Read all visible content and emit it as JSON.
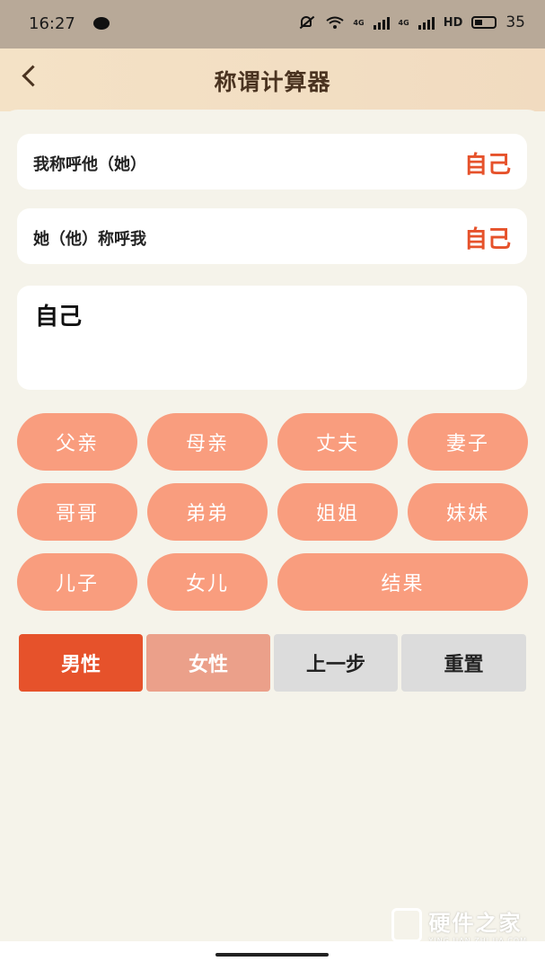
{
  "status_bar": {
    "time": "16:27",
    "battery": "35",
    "net1": "4G",
    "net2": "4G",
    "hd": "HD"
  },
  "header": {
    "title": "称谓计算器"
  },
  "rows": [
    {
      "label": "我称呼他（她）",
      "value": "自己"
    },
    {
      "label": "她（他）称呼我",
      "value": "自己"
    }
  ],
  "input": {
    "value": "自己"
  },
  "relation_buttons": {
    "father": "父亲",
    "mother": "母亲",
    "husband": "丈夫",
    "wife": "妻子",
    "elder_brother": "哥哥",
    "younger_brother": "弟弟",
    "elder_sister": "姐姐",
    "younger_sister": "妹妹",
    "son": "儿子",
    "daughter": "女儿",
    "result": "结果"
  },
  "controls": {
    "male": "男性",
    "female": "女性",
    "prev": "上一步",
    "reset": "重置"
  },
  "watermark": {
    "cn": "硬件之家",
    "en": "YING JIAN ZHI JIA.COM"
  },
  "colors": {
    "accent": "#e6522b",
    "pill": "#f99d7e",
    "header_bg": "#f4e2c6",
    "panel_bg": "#f5f3ea"
  }
}
